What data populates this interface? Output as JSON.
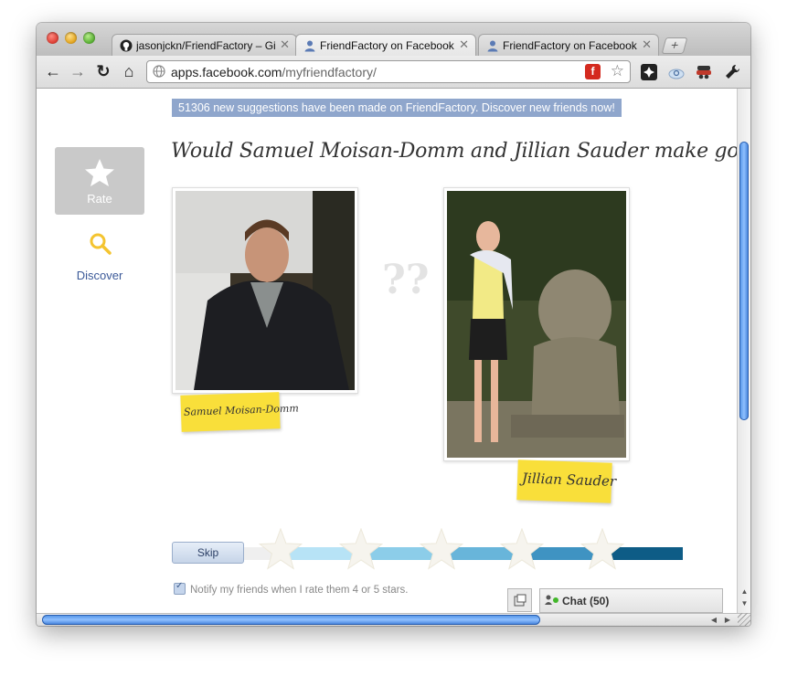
{
  "browser": {
    "tabs": [
      {
        "title": "jasonjckn/FriendFactory – Gi",
        "icon": "github-icon"
      },
      {
        "title": "FriendFactory on Facebook (",
        "icon": "facebook-user-icon"
      },
      {
        "title": "FriendFactory on Facebook (",
        "icon": "facebook-user-icon"
      }
    ],
    "new_tab_label": "+",
    "url_host": "apps.facebook.com",
    "url_path": "/myfriendfactory/"
  },
  "banner": {
    "text": "51306 new suggestions have been made on FriendFactory. Discover new friends now!"
  },
  "sidebar": {
    "rate_label": "Rate",
    "discover_label": "Discover"
  },
  "main": {
    "question": "Would Samuel Moisan-Domm and Jillian Sauder make good friends?",
    "person_left": "Samuel Moisan-Domm",
    "person_right": "Jillian Sauder",
    "separator_glyph": "??",
    "skip_label": "Skip",
    "rating": {
      "levels": 5,
      "colors": [
        "#b7e3f6",
        "#8ccde9",
        "#68b5da",
        "#3f93c2",
        "#0e5c86"
      ]
    },
    "notify_label": "Notify my friends when I rate them 4 or 5 stars.",
    "notify_checked": true
  },
  "chat": {
    "label": "Chat",
    "count": "(50)"
  },
  "colors": {
    "accent": "#3b5998",
    "note": "#f9df3a",
    "banner": "#8fa6cc"
  }
}
